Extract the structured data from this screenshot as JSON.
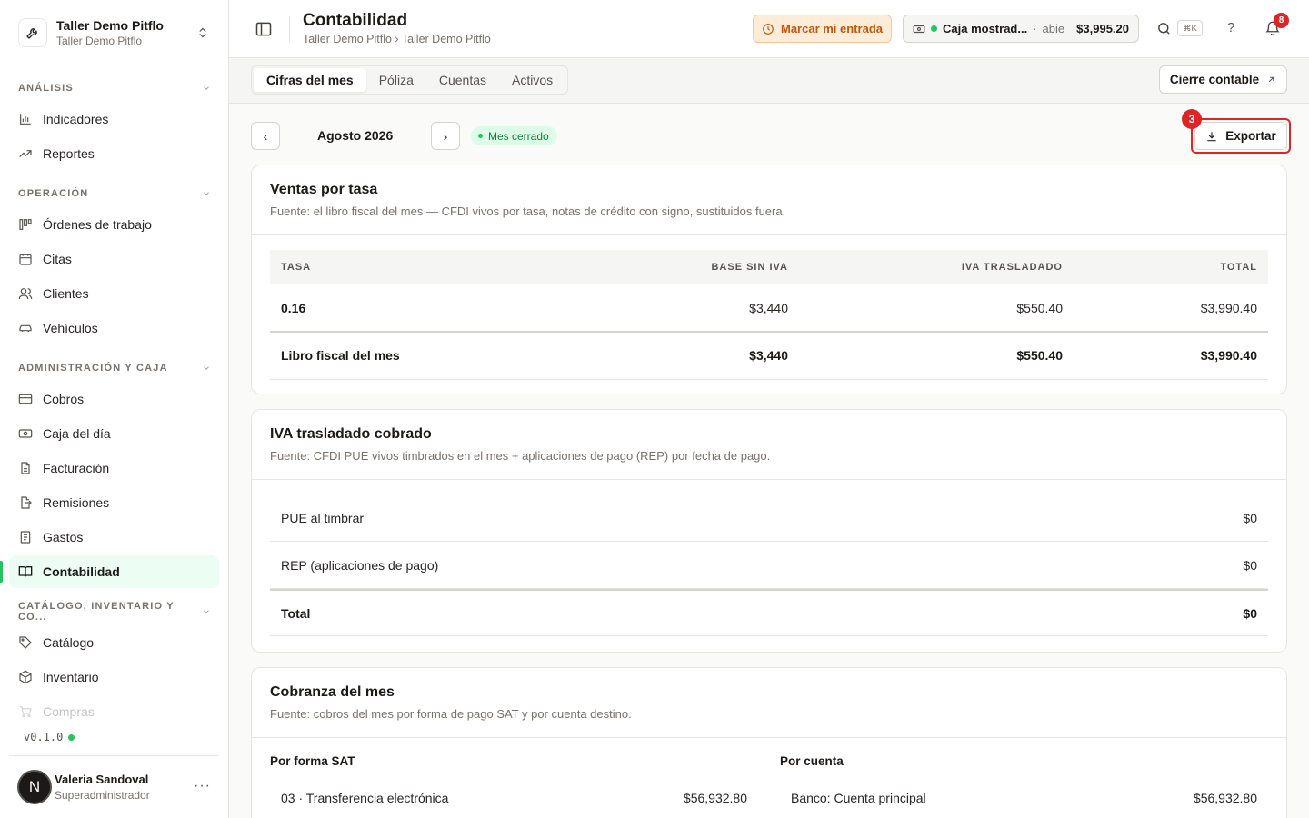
{
  "org": {
    "name": "Taller Demo Pitflo",
    "sub": "Taller Demo Pitflo"
  },
  "sidebar": {
    "sections": [
      {
        "label": "ANÁLISIS"
      },
      {
        "label": "OPERACIÓN"
      },
      {
        "label": "ADMINISTRACIÓN Y CAJA"
      },
      {
        "label": "CATÁLOGO, INVENTARIO Y CO..."
      }
    ],
    "items": [
      {
        "label": "Indicadores",
        "icon": "bar-chart-icon"
      },
      {
        "label": "Reportes",
        "icon": "trend-icon"
      },
      {
        "label": "Órdenes de trabajo",
        "icon": "kanban-icon"
      },
      {
        "label": "Citas",
        "icon": "calendar-icon"
      },
      {
        "label": "Clientes",
        "icon": "users-icon"
      },
      {
        "label": "Vehículos",
        "icon": "car-icon"
      },
      {
        "label": "Cobros",
        "icon": "card-icon"
      },
      {
        "label": "Caja del día",
        "icon": "cash-icon"
      },
      {
        "label": "Facturación",
        "icon": "invoice-icon"
      },
      {
        "label": "Remisiones",
        "icon": "file-out-icon"
      },
      {
        "label": "Gastos",
        "icon": "receipt-icon"
      },
      {
        "label": "Contabilidad",
        "icon": "book-icon"
      },
      {
        "label": "Catálogo",
        "icon": "tag-icon"
      },
      {
        "label": "Inventario",
        "icon": "box-icon"
      },
      {
        "label": "Compras",
        "icon": "cart-icon"
      }
    ],
    "version": "v0.1.0",
    "user": {
      "initial": "N",
      "name": "Valeria Sandoval",
      "role": "Superadministrador"
    }
  },
  "header": {
    "title": "Contabilidad",
    "breadcrumb": "Taller Demo Pitflo › Taller Demo Pitflo",
    "clock_label": "Marcar mi entrada",
    "caja": {
      "name": "Caja mostrad...",
      "status": "abie",
      "amount": "$3,995.20"
    },
    "kbd": "⌘K",
    "help": "?",
    "notifications": "8"
  },
  "tabs": [
    "Cifras del mes",
    "Póliza",
    "Cuentas",
    "Activos"
  ],
  "cierre_label": "Cierre contable",
  "month": {
    "label": "Agosto 2026",
    "prev": "‹",
    "next": "›",
    "status": "Mes cerrado"
  },
  "export": {
    "label": "Exportar",
    "step": "3"
  },
  "ventas": {
    "title": "Ventas por tasa",
    "subtitle": "Fuente: el libro fiscal del mes — CFDI vivos por tasa, notas de crédito con signo, sustituidos fuera.",
    "columns": [
      "TASA",
      "BASE SIN IVA",
      "IVA TRASLADADO",
      "TOTAL"
    ],
    "rows": [
      [
        "0.16",
        "$3,440",
        "$550.40",
        "$3,990.40"
      ]
    ],
    "total": [
      "Libro fiscal del mes",
      "$3,440",
      "$550.40",
      "$3,990.40"
    ]
  },
  "iva": {
    "title": "IVA trasladado cobrado",
    "subtitle": "Fuente: CFDI PUE vivos timbrados en el mes + aplicaciones de pago (REP) por fecha de pago.",
    "rows": [
      {
        "label": "PUE al timbrar",
        "value": "$0"
      },
      {
        "label": "REP (aplicaciones de pago)",
        "value": "$0"
      }
    ],
    "total": {
      "label": "Total",
      "value": "$0"
    }
  },
  "cobranza": {
    "title": "Cobranza del mes",
    "subtitle": "Fuente: cobros del mes por forma de pago SAT y por cuenta destino.",
    "left_title": "Por forma SAT",
    "left_row": {
      "label": "03 · Transferencia electrónica",
      "value": "$56,932.80"
    },
    "right_title": "Por cuenta",
    "right_row": {
      "label": "Banco: Cuenta principal",
      "value": "$56,932.80"
    }
  },
  "colors": {
    "accent": "#22c55e",
    "danger": "#dc2626",
    "warning_bg": "#fdecd8"
  }
}
